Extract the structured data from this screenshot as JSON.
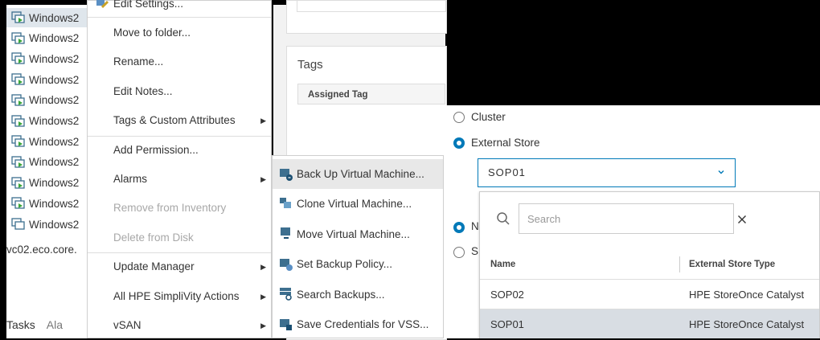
{
  "inventory": {
    "vm_items": [
      "Windows2",
      "Windows2",
      "Windows2",
      "Windows2",
      "Windows2",
      "Windows2",
      "Windows2",
      "Windows2",
      "Windows2",
      "Windows2",
      "Windows2"
    ],
    "vcenter_label": "vc02.eco.core.",
    "bottom_tabs": [
      "Tasks",
      "Ala"
    ]
  },
  "context_menu": {
    "top_partial": "Edit Settings...",
    "items": [
      {
        "label": "Move to folder...",
        "disabled": false,
        "submenu": false
      },
      {
        "label": "Rename...",
        "disabled": false,
        "submenu": false
      },
      {
        "label": "Edit Notes...",
        "disabled": false,
        "submenu": false
      },
      {
        "label": "Tags & Custom Attributes",
        "disabled": false,
        "submenu": true
      },
      {
        "label": "Add Permission...",
        "disabled": false,
        "submenu": false
      },
      {
        "label": "Alarms",
        "disabled": false,
        "submenu": true
      },
      {
        "label": "Remove from Inventory",
        "disabled": true,
        "submenu": false
      },
      {
        "label": "Delete from Disk",
        "disabled": true,
        "submenu": false
      },
      {
        "label": "Update Manager",
        "disabled": false,
        "submenu": true
      },
      {
        "label": "All HPE SimpliVity Actions",
        "disabled": false,
        "submenu": true
      },
      {
        "label": "vSAN",
        "disabled": false,
        "submenu": true
      }
    ]
  },
  "submenu": {
    "items": [
      {
        "label": "Back Up Virtual Machine...",
        "icon": "backup-vm-icon"
      },
      {
        "label": "Clone Virtual Machine...",
        "icon": "clone-vm-icon"
      },
      {
        "label": "Move Virtual Machine...",
        "icon": "move-vm-icon"
      },
      {
        "label": "Set Backup Policy...",
        "icon": "backup-policy-icon"
      },
      {
        "label": "Search Backups...",
        "icon": "search-backups-icon"
      },
      {
        "label": "Save Credentials for VSS...",
        "icon": "credentials-icon"
      }
    ]
  },
  "tags_panel": {
    "title": "Tags",
    "column": "Assigned Tag"
  },
  "destination": {
    "radio_cluster": "Cluster",
    "radio_external": "External Store",
    "partial_radio_3": "N",
    "partial_radio_4": "S",
    "selected_store": "SOP01",
    "search_placeholder": "Search",
    "columns": [
      "Name",
      "External Store Type"
    ],
    "rows": [
      {
        "name": "SOP02",
        "type": "HPE StoreOnce Catalyst"
      },
      {
        "name": "SOP01",
        "type": "HPE StoreOnce Catalyst"
      }
    ],
    "accent_color": "#0079b8"
  }
}
